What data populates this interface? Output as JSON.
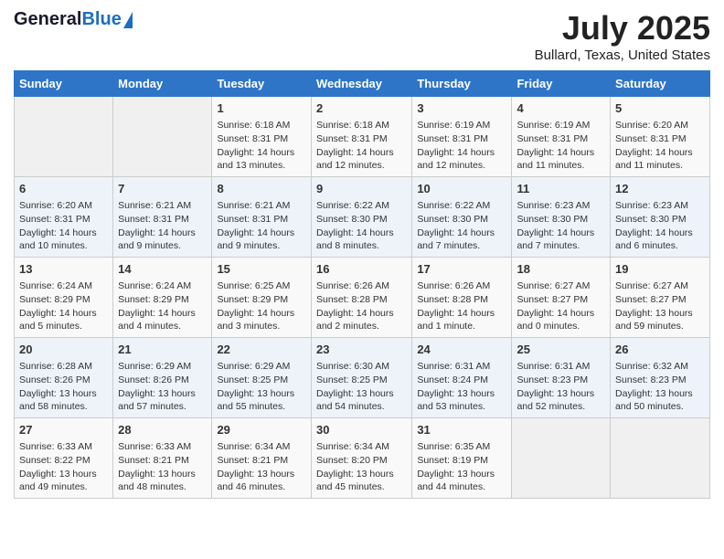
{
  "header": {
    "logo_general": "General",
    "logo_blue": "Blue",
    "title": "July 2025",
    "location": "Bullard, Texas, United States"
  },
  "weekdays": [
    "Sunday",
    "Monday",
    "Tuesday",
    "Wednesday",
    "Thursday",
    "Friday",
    "Saturday"
  ],
  "weeks": [
    [
      {
        "day": "",
        "info": ""
      },
      {
        "day": "",
        "info": ""
      },
      {
        "day": "1",
        "info": "Sunrise: 6:18 AM\nSunset: 8:31 PM\nDaylight: 14 hours and 13 minutes."
      },
      {
        "day": "2",
        "info": "Sunrise: 6:18 AM\nSunset: 8:31 PM\nDaylight: 14 hours and 12 minutes."
      },
      {
        "day": "3",
        "info": "Sunrise: 6:19 AM\nSunset: 8:31 PM\nDaylight: 14 hours and 12 minutes."
      },
      {
        "day": "4",
        "info": "Sunrise: 6:19 AM\nSunset: 8:31 PM\nDaylight: 14 hours and 11 minutes."
      },
      {
        "day": "5",
        "info": "Sunrise: 6:20 AM\nSunset: 8:31 PM\nDaylight: 14 hours and 11 minutes."
      }
    ],
    [
      {
        "day": "6",
        "info": "Sunrise: 6:20 AM\nSunset: 8:31 PM\nDaylight: 14 hours and 10 minutes."
      },
      {
        "day": "7",
        "info": "Sunrise: 6:21 AM\nSunset: 8:31 PM\nDaylight: 14 hours and 9 minutes."
      },
      {
        "day": "8",
        "info": "Sunrise: 6:21 AM\nSunset: 8:31 PM\nDaylight: 14 hours and 9 minutes."
      },
      {
        "day": "9",
        "info": "Sunrise: 6:22 AM\nSunset: 8:30 PM\nDaylight: 14 hours and 8 minutes."
      },
      {
        "day": "10",
        "info": "Sunrise: 6:22 AM\nSunset: 8:30 PM\nDaylight: 14 hours and 7 minutes."
      },
      {
        "day": "11",
        "info": "Sunrise: 6:23 AM\nSunset: 8:30 PM\nDaylight: 14 hours and 7 minutes."
      },
      {
        "day": "12",
        "info": "Sunrise: 6:23 AM\nSunset: 8:30 PM\nDaylight: 14 hours and 6 minutes."
      }
    ],
    [
      {
        "day": "13",
        "info": "Sunrise: 6:24 AM\nSunset: 8:29 PM\nDaylight: 14 hours and 5 minutes."
      },
      {
        "day": "14",
        "info": "Sunrise: 6:24 AM\nSunset: 8:29 PM\nDaylight: 14 hours and 4 minutes."
      },
      {
        "day": "15",
        "info": "Sunrise: 6:25 AM\nSunset: 8:29 PM\nDaylight: 14 hours and 3 minutes."
      },
      {
        "day": "16",
        "info": "Sunrise: 6:26 AM\nSunset: 8:28 PM\nDaylight: 14 hours and 2 minutes."
      },
      {
        "day": "17",
        "info": "Sunrise: 6:26 AM\nSunset: 8:28 PM\nDaylight: 14 hours and 1 minute."
      },
      {
        "day": "18",
        "info": "Sunrise: 6:27 AM\nSunset: 8:27 PM\nDaylight: 14 hours and 0 minutes."
      },
      {
        "day": "19",
        "info": "Sunrise: 6:27 AM\nSunset: 8:27 PM\nDaylight: 13 hours and 59 minutes."
      }
    ],
    [
      {
        "day": "20",
        "info": "Sunrise: 6:28 AM\nSunset: 8:26 PM\nDaylight: 13 hours and 58 minutes."
      },
      {
        "day": "21",
        "info": "Sunrise: 6:29 AM\nSunset: 8:26 PM\nDaylight: 13 hours and 57 minutes."
      },
      {
        "day": "22",
        "info": "Sunrise: 6:29 AM\nSunset: 8:25 PM\nDaylight: 13 hours and 55 minutes."
      },
      {
        "day": "23",
        "info": "Sunrise: 6:30 AM\nSunset: 8:25 PM\nDaylight: 13 hours and 54 minutes."
      },
      {
        "day": "24",
        "info": "Sunrise: 6:31 AM\nSunset: 8:24 PM\nDaylight: 13 hours and 53 minutes."
      },
      {
        "day": "25",
        "info": "Sunrise: 6:31 AM\nSunset: 8:23 PM\nDaylight: 13 hours and 52 minutes."
      },
      {
        "day": "26",
        "info": "Sunrise: 6:32 AM\nSunset: 8:23 PM\nDaylight: 13 hours and 50 minutes."
      }
    ],
    [
      {
        "day": "27",
        "info": "Sunrise: 6:33 AM\nSunset: 8:22 PM\nDaylight: 13 hours and 49 minutes."
      },
      {
        "day": "28",
        "info": "Sunrise: 6:33 AM\nSunset: 8:21 PM\nDaylight: 13 hours and 48 minutes."
      },
      {
        "day": "29",
        "info": "Sunrise: 6:34 AM\nSunset: 8:21 PM\nDaylight: 13 hours and 46 minutes."
      },
      {
        "day": "30",
        "info": "Sunrise: 6:34 AM\nSunset: 8:20 PM\nDaylight: 13 hours and 45 minutes."
      },
      {
        "day": "31",
        "info": "Sunrise: 6:35 AM\nSunset: 8:19 PM\nDaylight: 13 hours and 44 minutes."
      },
      {
        "day": "",
        "info": ""
      },
      {
        "day": "",
        "info": ""
      }
    ]
  ]
}
